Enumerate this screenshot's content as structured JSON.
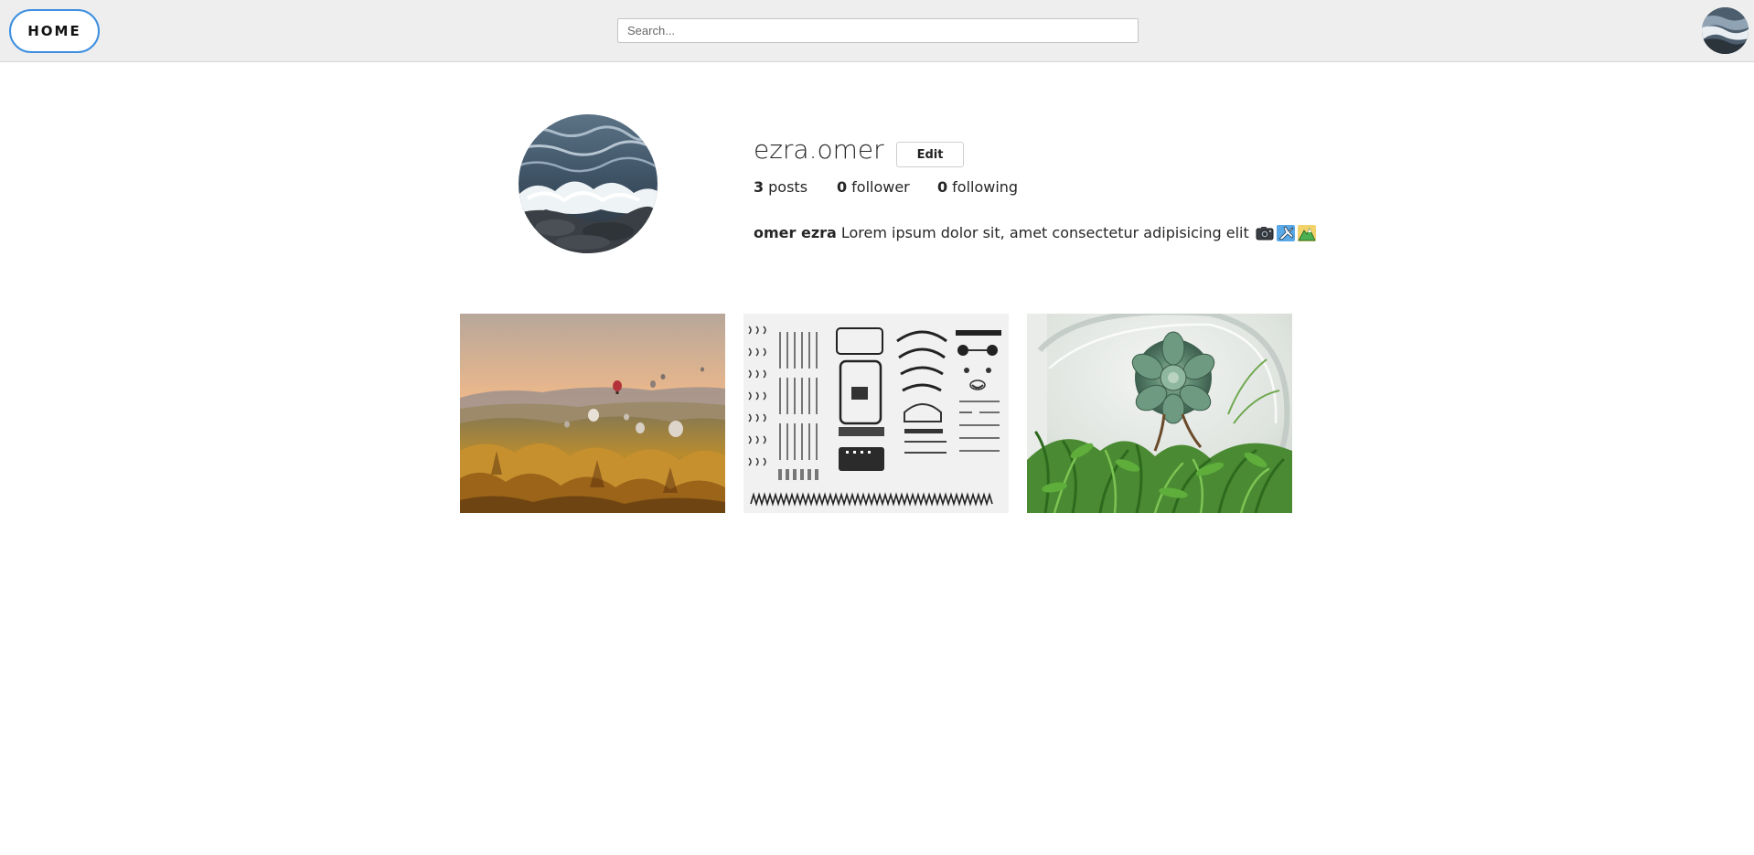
{
  "header": {
    "home_label": "HOME",
    "search_placeholder": "Search...",
    "search_value": "",
    "avatar_icon": "ocean-wave-avatar"
  },
  "profile": {
    "username": "ezra.omer",
    "edit_label": "Edit",
    "stats": {
      "posts_count": "3",
      "posts_label": "posts",
      "follower_count": "0",
      "follower_label": "follower",
      "following_count": "0",
      "following_label": "following"
    },
    "bio": {
      "name": "omer ezra",
      "text": "Lorem ipsum dolor sit, amet consectetur adipisicing elit",
      "emojis": [
        "camera-icon",
        "airplane-icon",
        "mountain-icon"
      ]
    },
    "avatar_icon": "ocean-wave-avatar"
  },
  "posts": [
    {
      "image": "hot-air-balloons-valley"
    },
    {
      "image": "typewriter-parts-flatlay"
    },
    {
      "image": "succulent-terrarium"
    }
  ],
  "colors": {
    "topbar_bg": "#eeeeee",
    "home_border": "#3d8fe0"
  }
}
